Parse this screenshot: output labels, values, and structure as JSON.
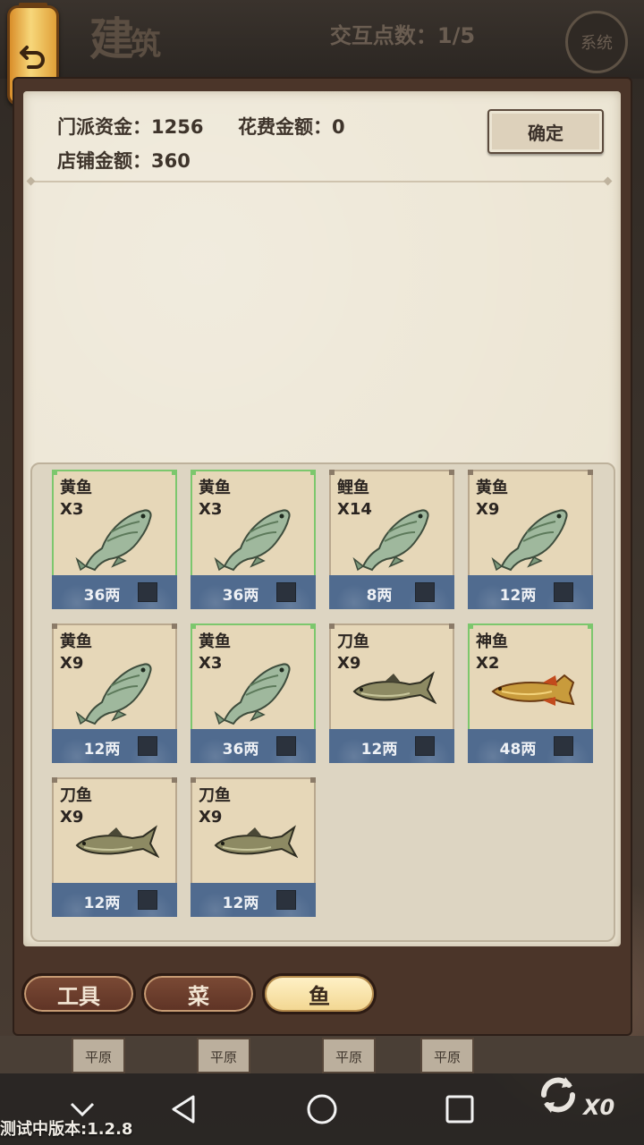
{
  "header": {
    "title_main": "建",
    "title_small": "筑",
    "interaction_points": "交互点数：1/5",
    "system_label": "系统"
  },
  "panel": {
    "sect_funds": "门派资金：1256",
    "spend_amount": "花费金额：0",
    "shop_amount": "店铺金额：360",
    "confirm_label": "确定"
  },
  "items": [
    {
      "name": "黄鱼",
      "qty": "X3",
      "price": "36两",
      "fish": "carp",
      "selected": true
    },
    {
      "name": "黄鱼",
      "qty": "X3",
      "price": "36两",
      "fish": "carp",
      "selected": true
    },
    {
      "name": "鲤鱼",
      "qty": "X14",
      "price": "8两",
      "fish": "carp",
      "selected": false
    },
    {
      "name": "黄鱼",
      "qty": "X9",
      "price": "12两",
      "fish": "carp",
      "selected": false
    },
    {
      "name": "黄鱼",
      "qty": "X9",
      "price": "12两",
      "fish": "carp",
      "selected": false
    },
    {
      "name": "黄鱼",
      "qty": "X3",
      "price": "36两",
      "fish": "carp",
      "selected": true
    },
    {
      "name": "刀鱼",
      "qty": "X9",
      "price": "12两",
      "fish": "knife",
      "selected": false
    },
    {
      "name": "神鱼",
      "qty": "X2",
      "price": "48两",
      "fish": "arowana",
      "selected": true
    },
    {
      "name": "刀鱼",
      "qty": "X9",
      "price": "12两",
      "fish": "knife",
      "selected": false
    },
    {
      "name": "刀鱼",
      "qty": "X9",
      "price": "12两",
      "fish": "knife",
      "selected": false
    }
  ],
  "tabs": [
    {
      "label": "工具",
      "active": false
    },
    {
      "label": "菜",
      "active": false
    },
    {
      "label": "鱼",
      "active": true
    }
  ],
  "background_tiles": [
    "平原",
    "平原",
    "平原",
    "平原"
  ],
  "version": "测试中版本:1.2.8",
  "refresh_count": "X0",
  "colors": {
    "price_bar": "#506b8f",
    "selected_border": "#7cc76d",
    "parchment": "#ece5d3"
  },
  "icons": [
    "back-arrow-icon",
    "carp-fish-icon",
    "knife-fish-icon",
    "arowana-fish-icon",
    "checkbox-icon",
    "nav-back-icon",
    "nav-home-icon",
    "nav-recents-icon",
    "nav-hide-icon",
    "refresh-icon"
  ]
}
